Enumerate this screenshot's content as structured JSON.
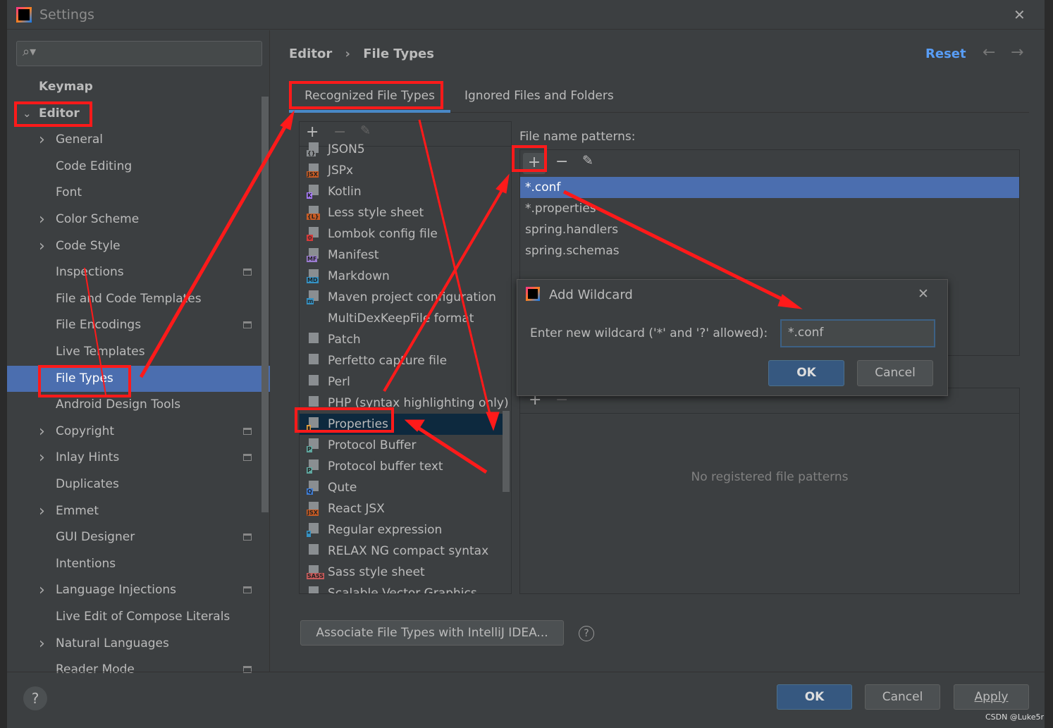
{
  "window": {
    "title": "Settings",
    "close": "✕"
  },
  "sidebar": {
    "search_placeholder": "",
    "items": [
      {
        "label": "Keymap",
        "level": 0,
        "bold": true
      },
      {
        "label": "Editor",
        "level": 0,
        "bold": true,
        "expanded": true
      },
      {
        "label": "General",
        "level": 1,
        "chevron": true
      },
      {
        "label": "Code Editing",
        "level": 1
      },
      {
        "label": "Font",
        "level": 1
      },
      {
        "label": "Color Scheme",
        "level": 1,
        "chevron": true
      },
      {
        "label": "Code Style",
        "level": 1,
        "chevron": true
      },
      {
        "label": "Inspections",
        "level": 1,
        "icon": true
      },
      {
        "label": "File and Code Templates",
        "level": 1
      },
      {
        "label": "File Encodings",
        "level": 1,
        "icon": true
      },
      {
        "label": "Live Templates",
        "level": 1
      },
      {
        "label": "File Types",
        "level": 1,
        "selected": true
      },
      {
        "label": "Android Design Tools",
        "level": 1
      },
      {
        "label": "Copyright",
        "level": 1,
        "chevron": true,
        "icon": true
      },
      {
        "label": "Inlay Hints",
        "level": 1,
        "chevron": true,
        "icon": true
      },
      {
        "label": "Duplicates",
        "level": 1
      },
      {
        "label": "Emmet",
        "level": 1,
        "chevron": true
      },
      {
        "label": "GUI Designer",
        "level": 1,
        "icon": true
      },
      {
        "label": "Intentions",
        "level": 1
      },
      {
        "label": "Language Injections",
        "level": 1,
        "chevron": true,
        "icon": true
      },
      {
        "label": "Live Edit of Compose Literals",
        "level": 1
      },
      {
        "label": "Natural Languages",
        "level": 1,
        "chevron": true
      },
      {
        "label": "Reader Mode",
        "level": 1,
        "icon": true
      }
    ]
  },
  "header": {
    "breadcrumb": [
      "Editor",
      "File Types"
    ],
    "reset": "Reset"
  },
  "tabs": [
    {
      "label": "Recognized File Types",
      "active": true
    },
    {
      "label": "Ignored Files and Folders"
    }
  ],
  "file_types": [
    {
      "label": "JSON5",
      "tag": "{}",
      "color": "#8a8e91"
    },
    {
      "label": "JSPx",
      "tag": "JSX",
      "color": "#c75b24"
    },
    {
      "label": "Kotlin",
      "tag": "K",
      "color": "#a97bff"
    },
    {
      "label": "Less style sheet",
      "tag": "{L}",
      "color": "#c75b24"
    },
    {
      "label": "Lombok config file",
      "tag": "⚙",
      "color": "#d63a3a"
    },
    {
      "label": "Manifest",
      "tag": "MF",
      "color": "#9a7bd0"
    },
    {
      "label": "Markdown",
      "tag": "MD",
      "color": "#3592c4"
    },
    {
      "label": "Maven project configuration",
      "tag": "m",
      "color": "#3592c4"
    },
    {
      "label": "MultiDexKeepFile format",
      "tag": "",
      "color": ""
    },
    {
      "label": "Patch",
      "tag": "",
      "color": "#8a8e91"
    },
    {
      "label": "Perfetto capture file",
      "tag": "",
      "color": "#dddddd"
    },
    {
      "label": "Perl",
      "tag": "",
      "color": "#8a8e91"
    },
    {
      "label": "PHP (syntax highlighting only)",
      "tag": "",
      "color": "#8a8e91"
    },
    {
      "label": "Properties",
      "tag": "▮",
      "color": "#e6a23c",
      "selected": true
    },
    {
      "label": "Protocol Buffer",
      "tag": "P",
      "color": "#5fa8a0"
    },
    {
      "label": "Protocol buffer text",
      "tag": "P",
      "color": "#5fa8a0"
    },
    {
      "label": "Qute",
      "tag": "Q",
      "color": "#3d7cd6"
    },
    {
      "label": "React JSX",
      "tag": "JSX",
      "color": "#c75b24"
    },
    {
      "label": "Regular expression",
      "tag": "*",
      "color": "#3592c4"
    },
    {
      "label": "RELAX NG compact syntax",
      "tag": "",
      "color": "#8a8e91"
    },
    {
      "label": "Sass style sheet",
      "tag": "SASS",
      "color": "#c75b5b"
    },
    {
      "label": "Scalable Vector Graphics",
      "tag": "",
      "color": "#8a8e91"
    }
  ],
  "patterns": {
    "label": "File name patterns:",
    "items": [
      {
        "label": "*.conf",
        "selected": true
      },
      {
        "label": "*.properties"
      },
      {
        "label": "spring.handlers"
      },
      {
        "label": "spring.schemas"
      }
    ]
  },
  "hashbangs": {
    "empty": "No registered file patterns"
  },
  "associate_button": "Associate File Types with IntelliJ IDEA...",
  "help": "?",
  "dialog": {
    "title": "Add Wildcard",
    "prompt": "Enter new wildcard ('*' and '?' allowed):",
    "value": "*.conf",
    "ok": "OK",
    "cancel": "Cancel"
  },
  "footer": {
    "ok": "OK",
    "cancel": "Cancel",
    "apply": "Apply"
  },
  "watermark": "CSDN @Luke5r",
  "colors": {
    "accent": "#4b6eaf",
    "annotation": "#ff1a1a",
    "link": "#589df6"
  }
}
